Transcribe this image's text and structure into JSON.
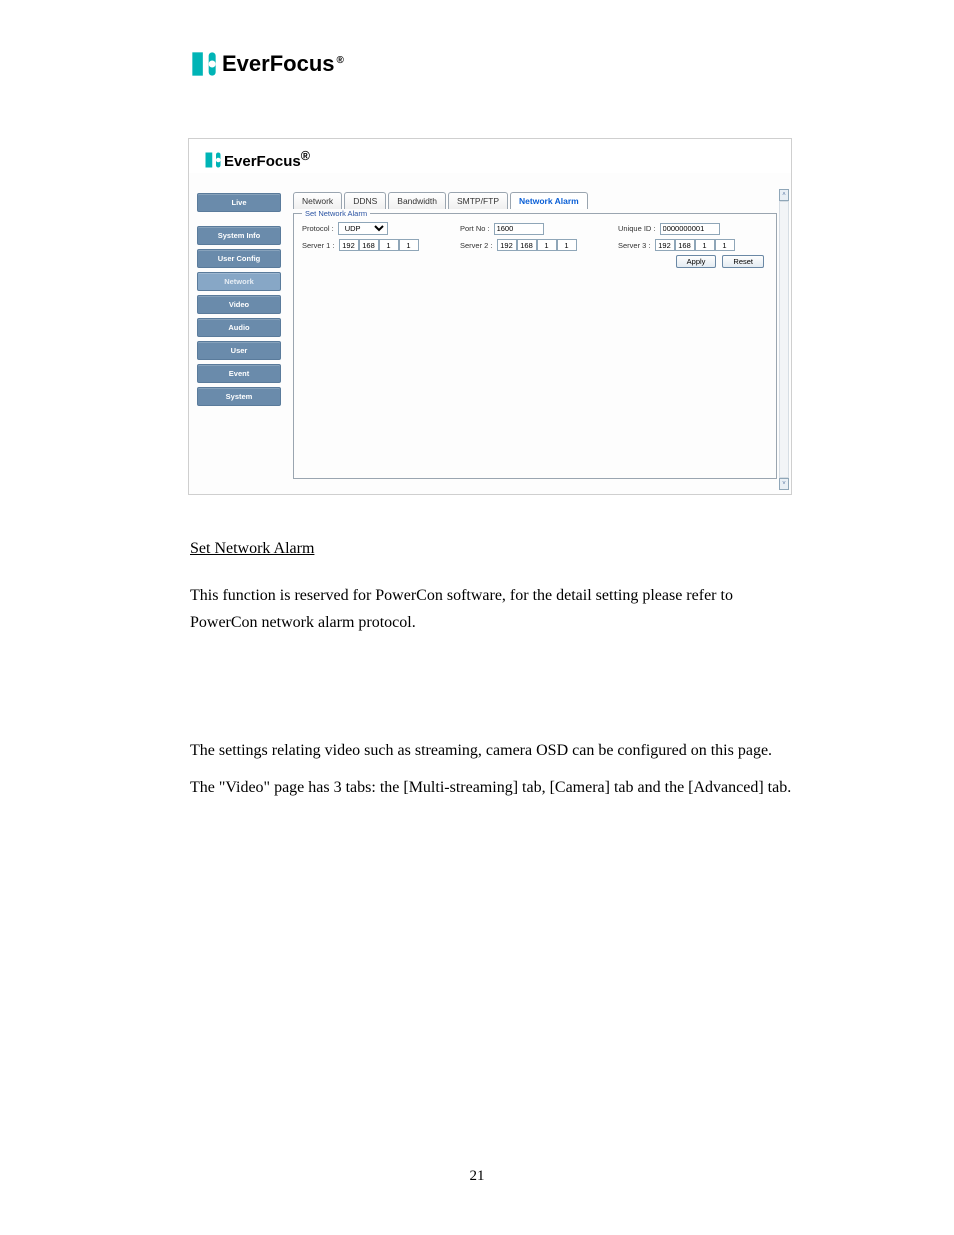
{
  "brand": {
    "name": "EverFocus"
  },
  "ui": {
    "sidebar": {
      "items": [
        {
          "label": "Live"
        },
        {
          "label": "System Info"
        },
        {
          "label": "User Config"
        },
        {
          "label": "Network"
        },
        {
          "label": "Video"
        },
        {
          "label": "Audio"
        },
        {
          "label": "User"
        },
        {
          "label": "Event"
        },
        {
          "label": "System"
        }
      ]
    },
    "tabs": {
      "items": [
        {
          "label": "Network"
        },
        {
          "label": "DDNS"
        },
        {
          "label": "Bandwidth"
        },
        {
          "label": "SMTP/FTP"
        },
        {
          "label": "Network Alarm"
        }
      ]
    },
    "fieldset": {
      "legend": "Set Network Alarm",
      "protocol_label": "Protocol :",
      "protocol_value": "UDP",
      "port_label": "Port No :",
      "port_value": "1600",
      "uid_label": "Unique ID :",
      "uid_value": "0000000001",
      "server1_label": "Server 1 :",
      "server2_label": "Server 2 :",
      "server3_label": "Server 3 :",
      "ip": [
        "192",
        "168",
        "1",
        "1"
      ],
      "apply_label": "Apply",
      "reset_label": "Reset"
    }
  },
  "text": {
    "heading": "Set Network Alarm",
    "p1": "This function is reserved for PowerCon software, for the detail setting please refer to PowerCon network alarm protocol.",
    "p2": "The settings relating video such as streaming, camera OSD can be configured on this page.",
    "p3": "The \"Video\" page has 3 tabs: the [Multi-streaming] tab, [Camera] tab and the [Advanced] tab."
  },
  "page_number": "21"
}
